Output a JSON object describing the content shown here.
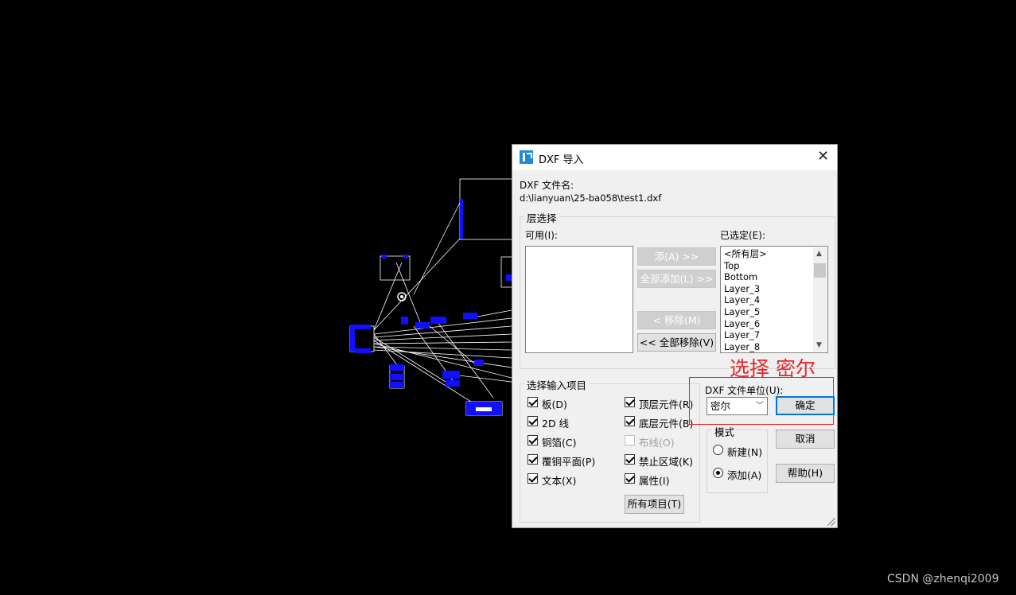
{
  "dialog": {
    "title": "DXF 导入",
    "file_label": "DXF 文件名:",
    "file_path": "d:\\lianyuan\\25-ba058\\test1.dxf"
  },
  "layers": {
    "group_title": "层选择",
    "available_label": "可用(I):",
    "selected_label": "已选定(E):",
    "selected_items": [
      "<所有层>",
      "Top",
      "Bottom",
      "Layer_3",
      "Layer_4",
      "Layer_5",
      "Layer_6",
      "Layer_7",
      "Layer_8"
    ],
    "btn_add": "添(A) >>",
    "btn_add_all": "全部添加(L) >>",
    "btn_remove": "< 移除(M)",
    "btn_remove_all": "<< 全部移除(V)"
  },
  "items": {
    "group_title": "选择输入项目",
    "checks": [
      {
        "label": "板(D)",
        "checked": true,
        "enabled": true
      },
      {
        "label": "2D 线",
        "checked": true,
        "enabled": true
      },
      {
        "label": "铜箔(C)",
        "checked": true,
        "enabled": true
      },
      {
        "label": "覆铜平面(P)",
        "checked": true,
        "enabled": true
      },
      {
        "label": "文本(X)",
        "checked": true,
        "enabled": true
      },
      {
        "label": "顶层元件(R)",
        "checked": true,
        "enabled": true
      },
      {
        "label": "底层元件(B)",
        "checked": true,
        "enabled": true
      },
      {
        "label": "布线(O)",
        "checked": false,
        "enabled": false
      },
      {
        "label": "禁止区域(K)",
        "checked": true,
        "enabled": true
      },
      {
        "label": "属性(I)",
        "checked": true,
        "enabled": true
      }
    ],
    "btn_all": "所有项目(T)"
  },
  "units": {
    "label": "DXF 文件单位(U):",
    "value": "密尔"
  },
  "mode": {
    "group_title": "模式",
    "options": [
      {
        "label": "新建(N)",
        "selected": false
      },
      {
        "label": "添加(A)",
        "selected": true
      }
    ]
  },
  "buttons": {
    "ok": "确定",
    "cancel": "取消",
    "help": "帮助(H)"
  },
  "annotation": {
    "text": "选择 密尔",
    "color": "#e8242a"
  },
  "watermark": "CSDN @zhenqi2009",
  "colors": {
    "accent": "#0078d7",
    "cad_pad": "#1010ff",
    "cad_line": "#ffffff"
  }
}
